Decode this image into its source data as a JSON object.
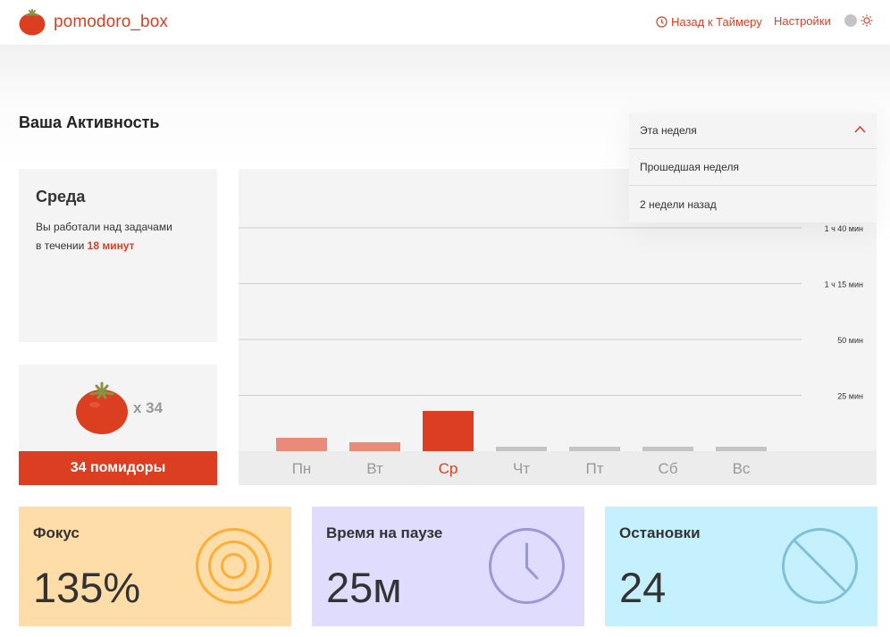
{
  "header": {
    "logo_text": "pomodoro_box",
    "back_label": "Назад к Таймеру",
    "settings_label": "Настройки",
    "theme_icon": "sun-icon",
    "brand_color": "#dc3e22"
  },
  "page": {
    "title": "Ваша Активность"
  },
  "period_dropdown": {
    "selected": "Эта неделя",
    "options": [
      "Прошедшая неделя",
      "2 недели назад"
    ]
  },
  "day_summary": {
    "day": "Среда",
    "text_line1": "Вы работали над задачами",
    "text_line2_prefix": "в течении",
    "duration": "18 минут"
  },
  "tomatoes": {
    "count_label": "x 34",
    "footer": "34 помидоры"
  },
  "chart_data": {
    "type": "bar",
    "categories": [
      "Пн",
      "Вт",
      "Ср",
      "Чт",
      "Пт",
      "Сб",
      "Вс"
    ],
    "values": [
      6,
      4,
      18,
      0,
      0,
      0,
      0
    ],
    "y_ticks": [
      {
        "value": 25,
        "label": "25 мин"
      },
      {
        "value": 50,
        "label": "50 мин"
      },
      {
        "value": 75,
        "label": "1 ч 15 мин"
      },
      {
        "value": 100,
        "label": "1 ч 40 мин"
      }
    ],
    "ylim": [
      0,
      125
    ],
    "selected": "Ср",
    "colors": {
      "normal": "#ea8a79",
      "selected": "#dc3e22",
      "empty": "#c4c4c4",
      "grid": "#cccccc"
    }
  },
  "stats": {
    "focus": {
      "title": "Фокус",
      "value": "135%",
      "icon": "target-icon",
      "color": "#ffdda9",
      "icon_color": "#ffae35"
    },
    "pause": {
      "title": "Время на паузе",
      "value": "25м",
      "icon": "clock-icon",
      "color": "#dfdcfe",
      "icon_color": "#9c97d7"
    },
    "stops": {
      "title": "Остановки",
      "value": "24",
      "icon": "stop-icon",
      "color": "#c5f1ff",
      "icon_color": "#7fc2d7"
    }
  }
}
